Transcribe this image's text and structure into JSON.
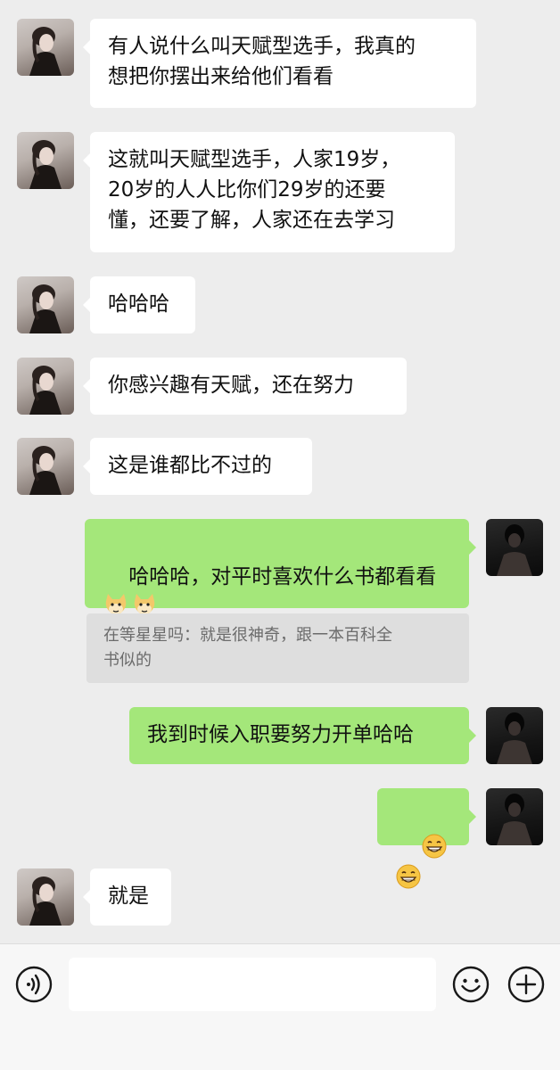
{
  "messages": [
    {
      "side": "left",
      "text": "有人说什么叫天赋型选手，我真的\n想把你摆出来给他们看看"
    },
    {
      "side": "left",
      "text": "这就叫天赋型选手，人家19岁，\n20岁的人人比你们29岁的还要\n懂，还要了解，人家还在去学习"
    },
    {
      "side": "left",
      "text": "哈哈哈"
    },
    {
      "side": "left",
      "text": "你感兴趣有天赋，还在努力"
    },
    {
      "side": "left",
      "text": "这是谁都比不过的"
    },
    {
      "side": "right",
      "text": "哈哈哈，对平时喜欢什么书都看看",
      "emojis": [
        "doge-emoji",
        "doge-emoji"
      ]
    },
    {
      "side": "right",
      "text": "我到时候入职要努力开单哈哈"
    },
    {
      "side": "right",
      "text": "",
      "emojis": [
        "grin-emoji",
        "grin-emoji"
      ]
    },
    {
      "side": "left",
      "text": "就是"
    }
  ],
  "quote": {
    "text": "在等星星吗：就是很神奇，跟一本百科全\n书似的"
  },
  "input_bar": {
    "voice_icon": "voice-icon",
    "emoji_icon": "emoji-icon",
    "plus_icon": "plus-icon",
    "input_value": ""
  }
}
